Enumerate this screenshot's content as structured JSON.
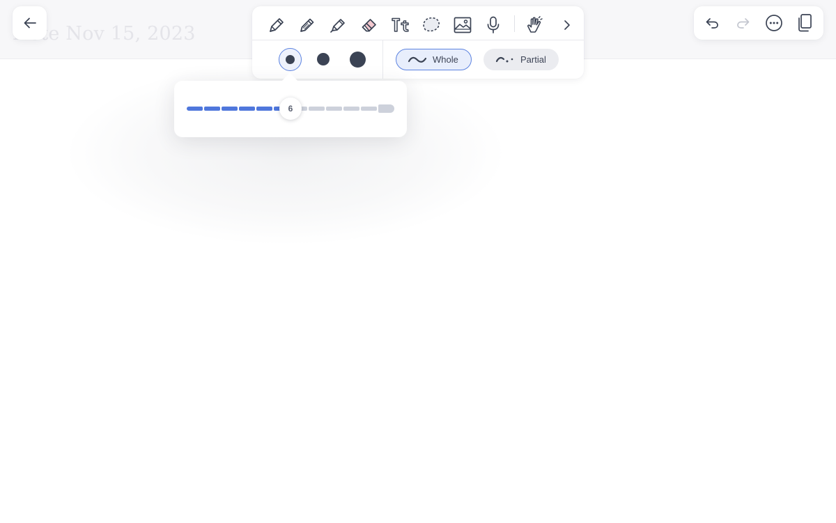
{
  "note": {
    "title": "Note Nov 15, 2023"
  },
  "nav": {
    "back_icon": "arrow-left-icon"
  },
  "toolbar": {
    "tools": [
      {
        "name": "pen",
        "icon": "pen-icon"
      },
      {
        "name": "pencil",
        "icon": "pencil-icon"
      },
      {
        "name": "highlighter",
        "icon": "highlighter-icon"
      },
      {
        "name": "eraser",
        "icon": "eraser-icon",
        "selected": true
      },
      {
        "name": "text",
        "icon": "text-icon",
        "glyph": "Tt"
      },
      {
        "name": "lasso",
        "icon": "lasso-icon"
      },
      {
        "name": "image",
        "icon": "image-icon"
      },
      {
        "name": "microphone",
        "icon": "microphone-icon"
      },
      {
        "name": "hand",
        "icon": "hand-icon"
      },
      {
        "name": "more-tools",
        "icon": "chevron-right-icon"
      }
    ],
    "eraser_sizes": [
      "small",
      "medium",
      "large"
    ],
    "selected_size": "small",
    "modes": {
      "whole_label": "Whole",
      "partial_label": "Partial",
      "selected": "Whole"
    }
  },
  "size_slider": {
    "value": "6",
    "max": 12
  },
  "actions": {
    "undo_icon": "undo-icon",
    "redo_icon": "redo-icon",
    "more_icon": "more-horizontal-icon",
    "pages_icon": "pages-icon"
  },
  "colors": {
    "accent": "#4f77dc",
    "track_off": "#cdd1db",
    "icon": "#3b4354",
    "eraser_pink": "#f4c9cf",
    "header_bg": "#f7f7f9"
  }
}
